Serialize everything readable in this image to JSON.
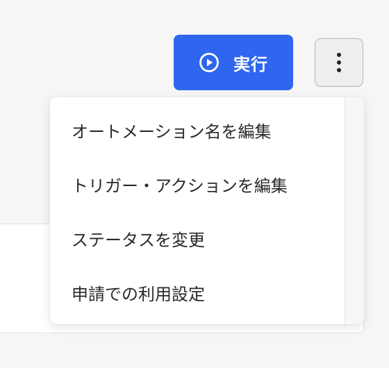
{
  "toolbar": {
    "run_button": {
      "label": "実行",
      "icon": "play-circle-icon"
    },
    "more_button": {
      "icon": "more-vertical-icon"
    }
  },
  "menu": {
    "items": [
      {
        "label": "オートメーション名を編集"
      },
      {
        "label": "トリガー・アクションを編集"
      },
      {
        "label": "ステータスを変更"
      },
      {
        "label": "申請での利用設定"
      }
    ]
  },
  "colors": {
    "accent": "#2f66f0",
    "background": "#f6f6f7",
    "text": "#2a2a2d"
  }
}
